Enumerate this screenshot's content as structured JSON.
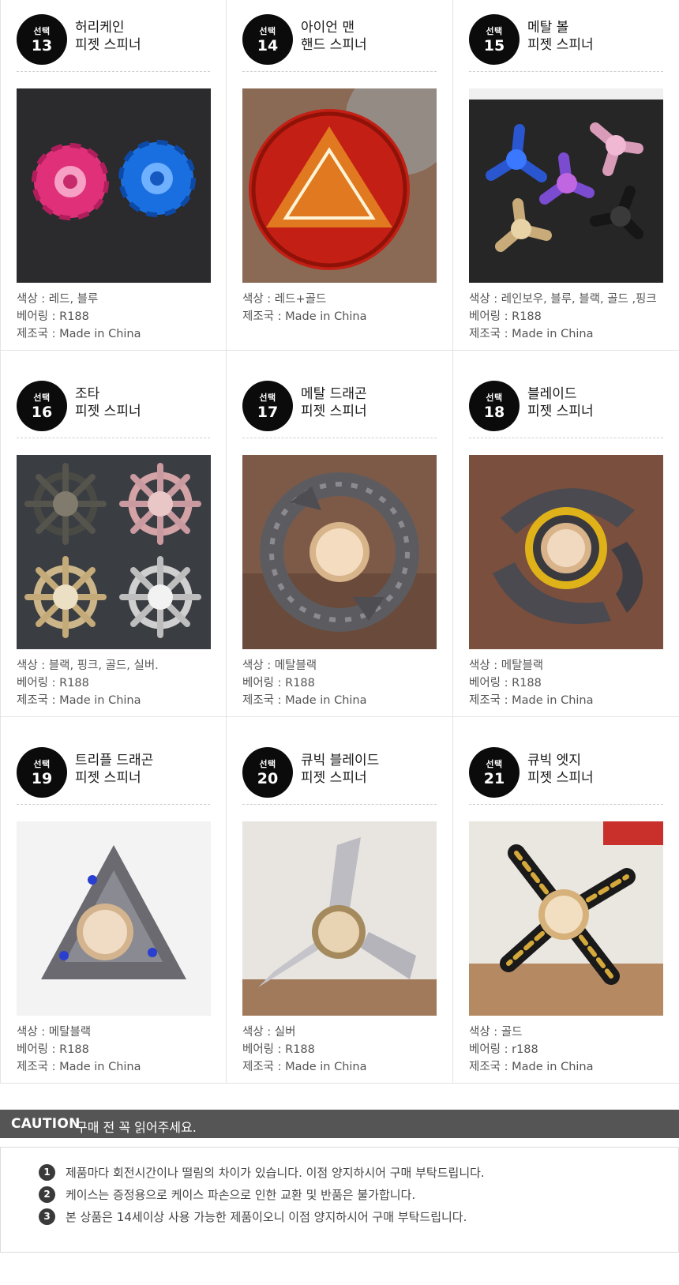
{
  "products": [
    {
      "badge_label": "선택",
      "number": "13",
      "name_line1": "허리케인",
      "name_line2": "피젯 스피너",
      "color": "색상 : 레드, 블루",
      "bearing": "베어링 : R188",
      "origin": "제조국 : Made in China"
    },
    {
      "badge_label": "선택",
      "number": "14",
      "name_line1": "아이언 맨",
      "name_line2": "핸드 스피너",
      "color": "색상 : 레드+골드",
      "bearing": "",
      "origin": "제조국 : Made in China"
    },
    {
      "badge_label": "선택",
      "number": "15",
      "name_line1": "메탈 볼",
      "name_line2": "피젯 스피너",
      "color": "색상 : 레인보우, 블루, 블랙, 골드 ,핑크",
      "bearing": "베어링 : R188",
      "origin": "제조국 : Made in China"
    },
    {
      "badge_label": "선택",
      "number": "16",
      "name_line1": "조타",
      "name_line2": "피젯 스피너",
      "color": "색상 : 블랙, 핑크, 골드, 실버.",
      "bearing": "베어링 : R188",
      "origin": "제조국 : Made in China"
    },
    {
      "badge_label": "선택",
      "number": "17",
      "name_line1": "메탈 드래곤",
      "name_line2": "피젯 스피너",
      "color": "색상 : 메탈블랙",
      "bearing": "베어링 : R188",
      "origin": "제조국 : Made in China"
    },
    {
      "badge_label": "선택",
      "number": "18",
      "name_line1": "블레이드",
      "name_line2": "피젯 스피너",
      "color": "색상 : 메탈블랙",
      "bearing": "베어링 : R188",
      "origin": "제조국 : Made in China"
    },
    {
      "badge_label": "선택",
      "number": "19",
      "name_line1": "트리플 드래곤",
      "name_line2": "피젯 스피너",
      "color": "색상 : 메탈블랙",
      "bearing": "베어링 : R188",
      "origin": "제조국 : Made in China"
    },
    {
      "badge_label": "선택",
      "number": "20",
      "name_line1": "큐빅 블레이드",
      "name_line2": "피젯 스피너",
      "color": "색상 : 실버",
      "bearing": "베어링 : R188",
      "origin": "제조국 : Made in China"
    },
    {
      "badge_label": "선택",
      "number": "21",
      "name_line1": "큐빅 엣지",
      "name_line2": "피젯 스피너",
      "color": "색상 : 골드",
      "bearing": "베어링 : r188",
      "origin": "제조국 : Made in China"
    }
  ],
  "caution": {
    "keyword": "CAUTION",
    "text": "구매 전 꼭 읽어주세요.",
    "notes": [
      {
        "num": "1",
        "text": "제품마다 회전시간이나 떨림의 차이가 있습니다. 이점 양지하시어 구매 부탁드립니다."
      },
      {
        "num": "2",
        "text": "케이스는 증정용으로 케이스 파손으로 인한 교환 및 반품은 불가합니다."
      },
      {
        "num": "3",
        "text": "본 상품은 14세이상 사용 가능한 제품이오니 이점 양지하시어 구매 부탁드립니다."
      }
    ]
  },
  "colors": {
    "badge": "#0b0b0b",
    "caution_bar": "#555555",
    "note_bullet": "#3a3a3a"
  }
}
